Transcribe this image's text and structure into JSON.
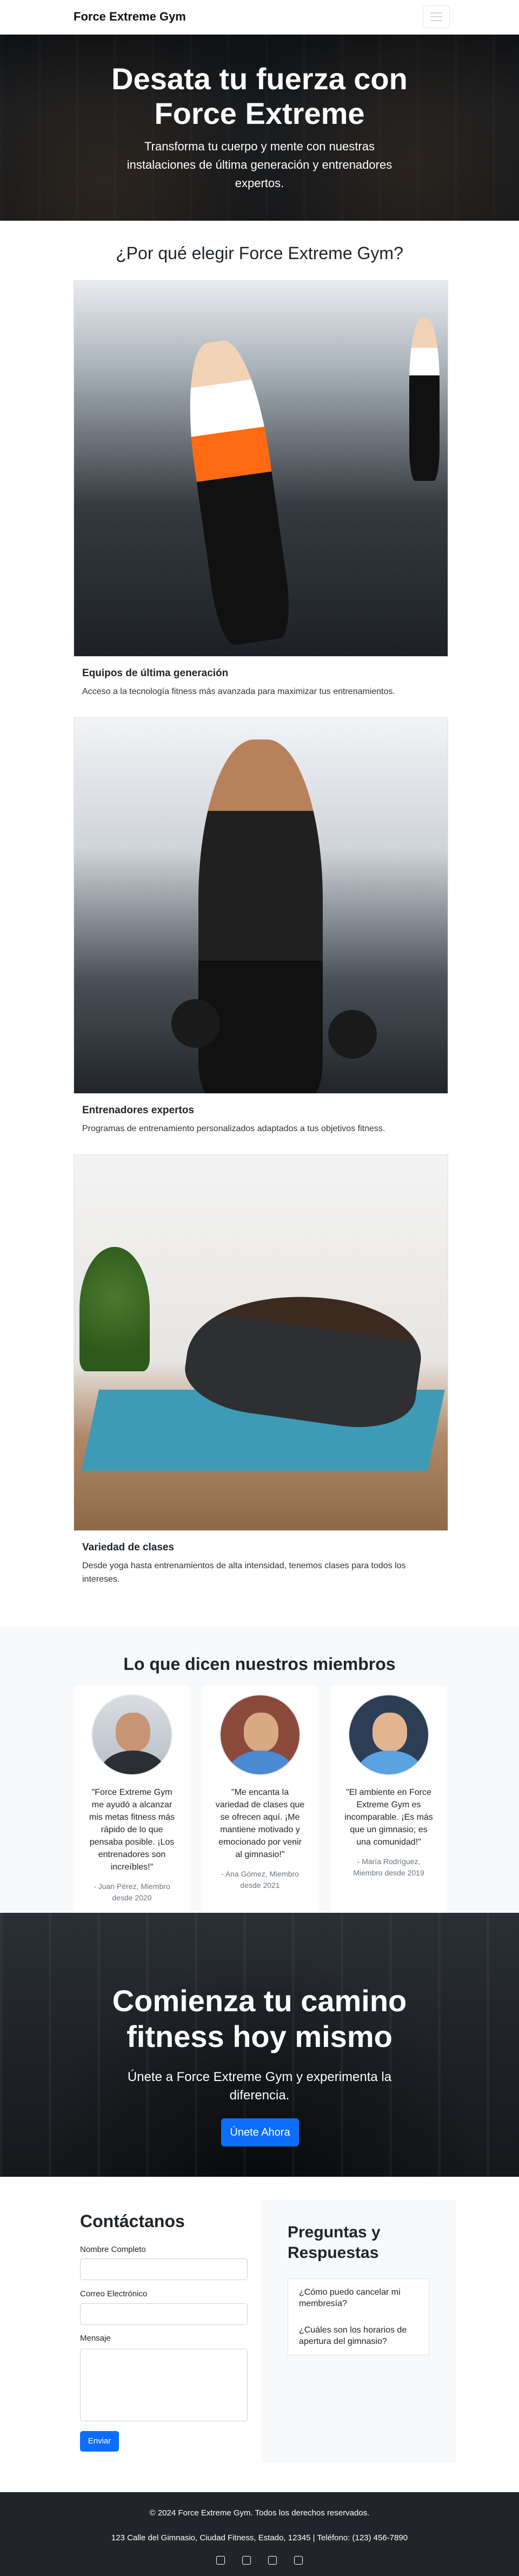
{
  "nav": {
    "brand": "Force Extreme Gym"
  },
  "hero": {
    "title": "Desata tu fuerza con Force Extreme",
    "subtitle": "Transforma tu cuerpo y mente con nuestras instalaciones de última generación y entrenadores expertos."
  },
  "why": {
    "title": "¿Por qué elegir Force Extreme Gym?",
    "features": [
      {
        "title": "Equipos de última generación",
        "text": "Acceso a la tecnología fitness más avanzada para maximizar tus entrenamientos."
      },
      {
        "title": "Entrenadores expertos",
        "text": "Programas de entrenamiento personalizados adaptados a tus objetivos fitness."
      },
      {
        "title": "Variedad de clases",
        "text": "Desde yoga hasta entrenamientos de alta intensidad, tenemos clases para todos los intereses."
      }
    ]
  },
  "testimonials": {
    "title": "Lo que dicen nuestros miembros",
    "items": [
      {
        "quote": "\"Force Extreme Gym me ayudó a alcanzar mis metas fitness más rápido de lo que pensaba posible. ¡Los entrenadores son increíbles!\"",
        "author": "- Juan Pérez, Miembro desde 2020"
      },
      {
        "quote": "\"Me encanta la variedad de clases que se ofrecen aquí. ¡Me mantiene motivado y emocionado por venir al gimnasio!\"",
        "author": "- Ana Gómez, Miembro desde 2021"
      },
      {
        "quote": "\"El ambiente en Force Extreme Gym es incomparable. ¡Es más que un gimnasio; es una comunidad!\"",
        "author": "- María Rodríguez, Miembro desde 2019"
      }
    ]
  },
  "cta": {
    "title": "Comienza tu camino fitness hoy mismo",
    "subtitle": "Únete a Force Extreme Gym y experimenta la diferencia.",
    "button": "Únete Ahora"
  },
  "contact": {
    "title": "Contáctanos",
    "name_label": "Nombre Completo",
    "email_label": "Correo Electrónico",
    "message_label": "Mensaje",
    "submit": "Enviar"
  },
  "faq": {
    "title": "Preguntas y Respuestas",
    "items": [
      "¿Cómo puedo cancelar mi membresía?",
      "¿Cuáles son los horarios de apertura del gimnasio?"
    ]
  },
  "footer": {
    "copyright": "© 2024 Force Extreme Gym. Todos los derechos reservados.",
    "address": "123 Calle del Gimnasio, Ciudad Fitness, Estado, 12345 | Teléfono: (123) 456-7890",
    "social_icons": [
      "facebook-icon",
      "twitter-icon",
      "instagram-icon",
      "youtube-icon"
    ]
  },
  "colors": {
    "primary": "#0d6efd",
    "footer_bg": "#212529",
    "section_bg": "#f8f9fa"
  }
}
